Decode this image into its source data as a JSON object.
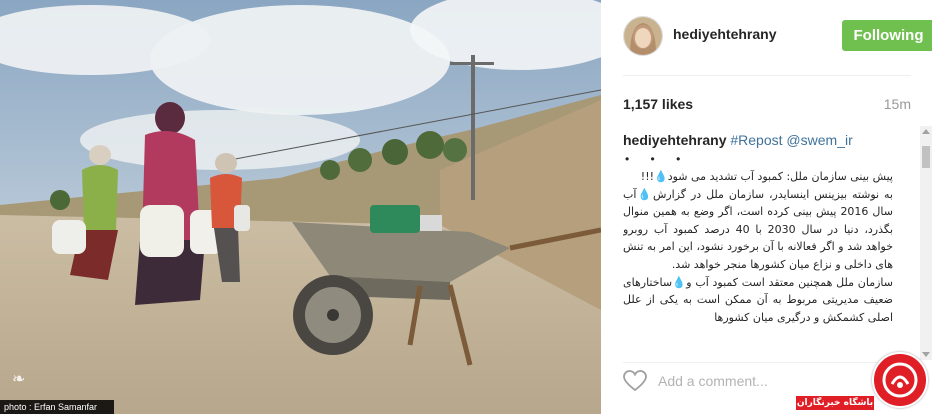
{
  "photo": {
    "credit": "photo : Erfan Samanfar"
  },
  "post": {
    "username": "hediyehtehrany",
    "follow_label": "Following",
    "likes": "1,157 likes",
    "time": "15m"
  },
  "caption": {
    "username": "hediyehtehrany",
    "repost_tag": "#Repost",
    "mention": "@swem_ir",
    "dots": "• • •",
    "paragraphs": [
      "پیش بینی سازمان ملل: کمبود آب تشدید می شود💧!!!",
      "به نوشته بیزینس اینسایدر، سازمان ملل در گزارش💧آب سال 2016 پیش بینی کرده است، اگر وضع به همین منوال بگذرد، دنیا در سال 2030 با 40 درصد کمبود آب روبرو خواهد شد و اگر فعالانه با آن برخورد نشود، این امر به تنش های داخلی و نزاع میان کشورها منجر خواهد شد.",
      "سازمان ملل همچنین معتقد است کمبود آب و💧ساختارهای ضعیف مدیریتی مربوط به آن ممکن است به یکی از علل اصلی کشمکش و درگیری میان کشورها"
    ]
  },
  "comment": {
    "placeholder": "Add a comment..."
  },
  "watermark": {
    "label": "باشگاه خبرنگاران"
  },
  "colors": {
    "follow": "#70c050",
    "hashtag": "#3f729b",
    "logo": "#e01e26"
  }
}
